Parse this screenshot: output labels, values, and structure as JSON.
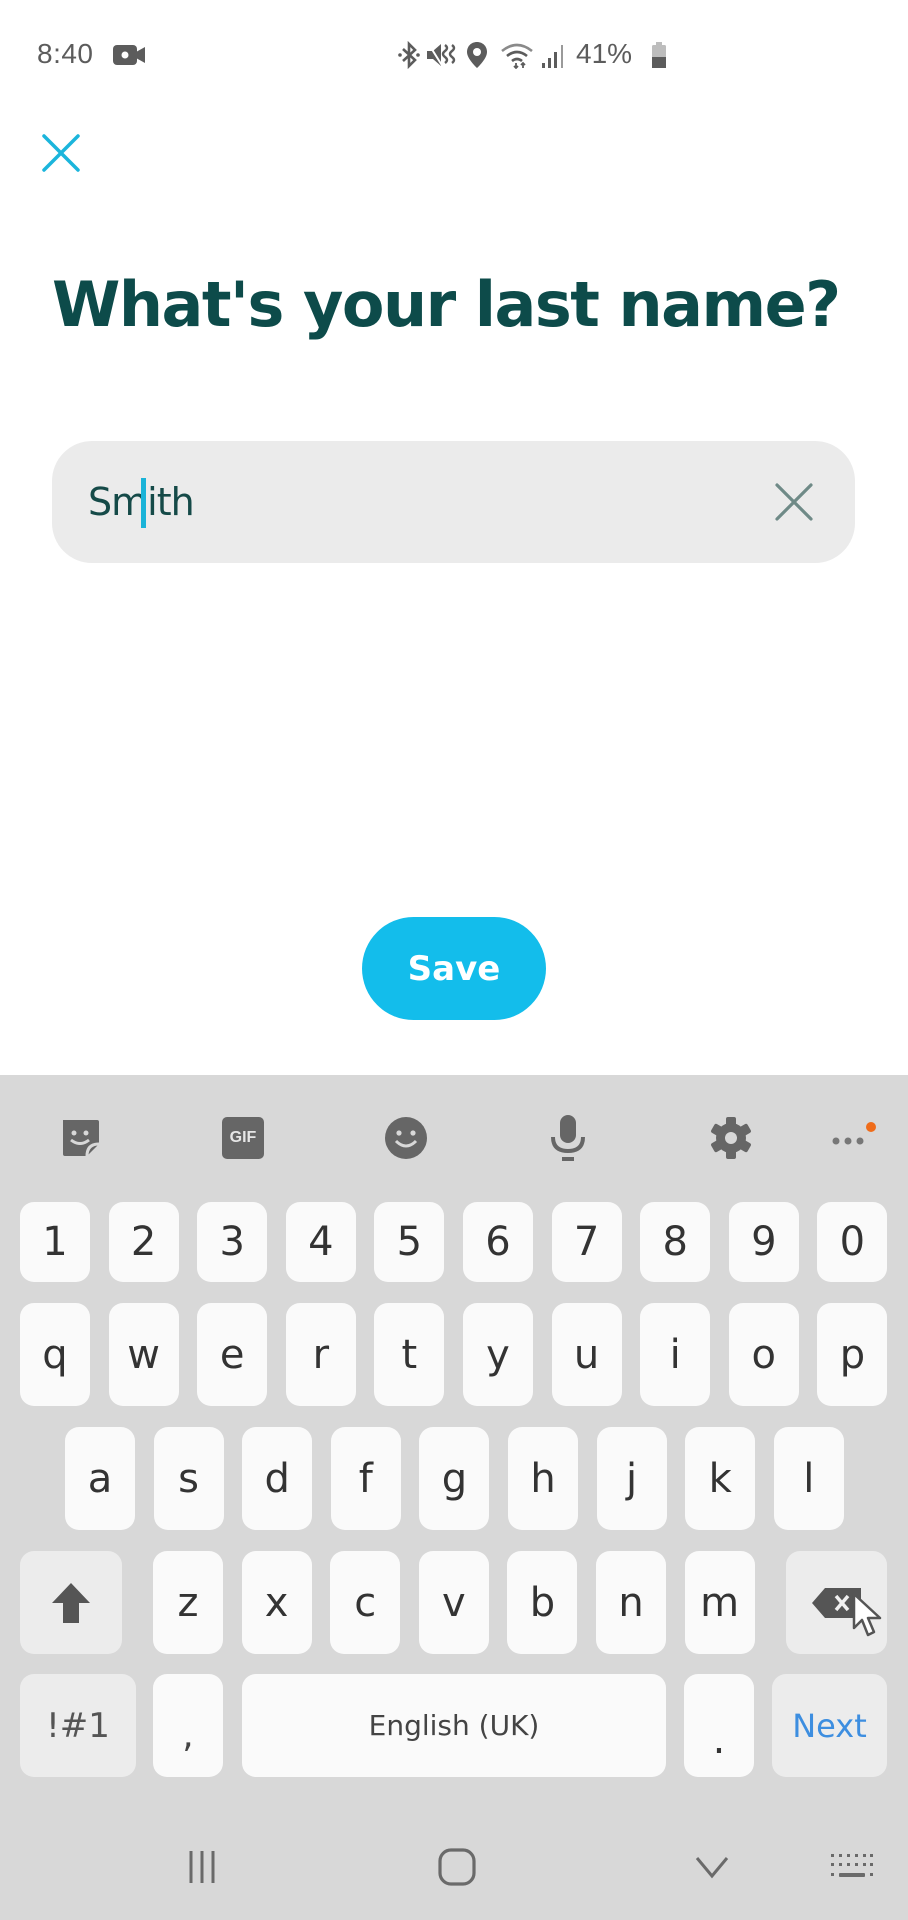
{
  "status_bar": {
    "time": "8:40",
    "battery_percent": "41%",
    "icons": [
      "video-recording-icon",
      "bluetooth-icon",
      "vibrate-icon",
      "location-icon",
      "wifi-icon",
      "signal-icon",
      "battery-icon"
    ]
  },
  "header": {
    "close_icon": "close-icon"
  },
  "form": {
    "title": "What's your last name?",
    "last_name_value": "Smith",
    "clear_icon": "clear-icon"
  },
  "save_button": {
    "label": "Save",
    "color": "#13BDEB"
  },
  "keyboard": {
    "toolbar": [
      "sticker-icon",
      "gif-icon",
      "emoji-icon",
      "microphone-icon",
      "settings-icon",
      "more-icon"
    ],
    "gif_label": "GIF",
    "number_row": [
      "1",
      "2",
      "3",
      "4",
      "5",
      "6",
      "7",
      "8",
      "9",
      "0"
    ],
    "row_1": [
      "q",
      "w",
      "e",
      "r",
      "t",
      "y",
      "u",
      "i",
      "o",
      "p"
    ],
    "row_2": [
      "a",
      "s",
      "d",
      "f",
      "g",
      "h",
      "j",
      "k",
      "l"
    ],
    "row_3": [
      "z",
      "x",
      "c",
      "v",
      "b",
      "n",
      "m"
    ],
    "symbols_label": "!#1",
    "comma_label": ",",
    "space_label": "English (UK)",
    "period_label": ".",
    "action_label": "Next"
  },
  "nav_bar": {
    "items": [
      "recents-icon",
      "home-icon",
      "back-icon",
      "keyboard-switch-icon"
    ]
  }
}
